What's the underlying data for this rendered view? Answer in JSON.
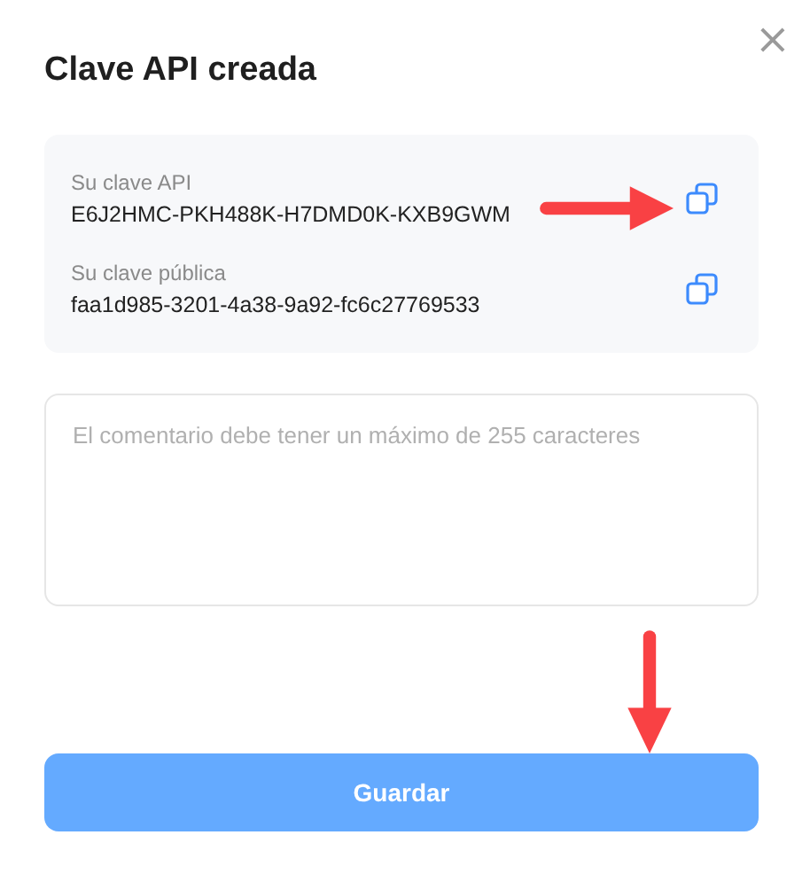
{
  "dialog": {
    "title": "Clave API creada",
    "close": "×"
  },
  "keys": [
    {
      "label": "Su clave API",
      "value": "E6J2HMC-PKH488K-H7DMD0K-KXB9GWM",
      "arrow": true
    },
    {
      "label": "Su clave pública",
      "value": "faa1d985-3201-4a38-9a92-fc6c27769533",
      "arrow": false
    }
  ],
  "comment": {
    "placeholder": "El comentario debe tener un máximo de 255 caracteres"
  },
  "buttons": [
    {
      "label": "Guardar",
      "arrow": true
    }
  ]
}
